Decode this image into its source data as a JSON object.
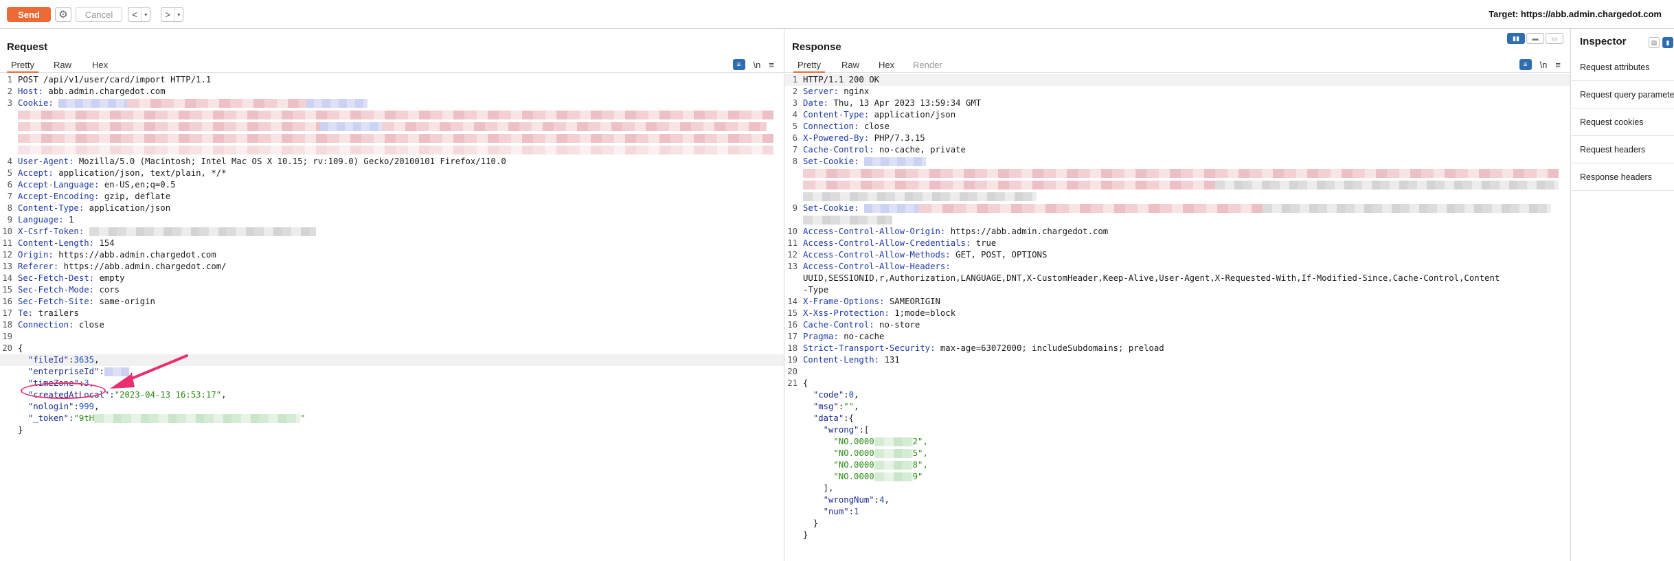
{
  "toolbar": {
    "send_label": "Send",
    "cancel_label": "Cancel",
    "back_glyph": "<",
    "forward_glyph": ">",
    "drop_glyph": "▾",
    "target_label": "Target: https://abb.admin.chargedot.com"
  },
  "request": {
    "title": "Request",
    "tabs": [
      "Pretty",
      "Raw",
      "Hex"
    ],
    "active_tab": "Pretty",
    "newline_label": "\\n",
    "lines": [
      {
        "n": "1",
        "plain": "POST /api/v1/user/card/import HTTP/1.1"
      },
      {
        "n": "2",
        "key": "Host:",
        "val": " abb.admin.chargedot.com"
      },
      {
        "n": "3",
        "key": "Cookie:",
        "val": ""
      },
      {
        "n": "4",
        "key": "User-Agent:",
        "val": " Mozilla/5.0 (Macintosh; Intel Mac OS X 10.15; rv:109.0) Gecko/20100101 Firefox/110.0"
      },
      {
        "n": "5",
        "key": "Accept:",
        "val": " application/json, text/plain, */*"
      },
      {
        "n": "6",
        "key": "Accept-Language:",
        "val": " en-US,en;q=0.5"
      },
      {
        "n": "7",
        "key": "Accept-Encoding:",
        "val": " gzip, deflate"
      },
      {
        "n": "8",
        "key": "Content-Type:",
        "val": " application/json"
      },
      {
        "n": "9",
        "key": "Language:",
        "val": " 1"
      },
      {
        "n": "10",
        "key": "X-Csrf-Token:",
        "val": ""
      },
      {
        "n": "11",
        "key": "Content-Length:",
        "val": " 154"
      },
      {
        "n": "12",
        "key": "Origin:",
        "val": " https://abb.admin.chargedot.com"
      },
      {
        "n": "13",
        "key": "Referer:",
        "val": " https://abb.admin.chargedot.com/"
      },
      {
        "n": "14",
        "key": "Sec-Fetch-Dest:",
        "val": " empty"
      },
      {
        "n": "15",
        "key": "Sec-Fetch-Mode:",
        "val": " cors"
      },
      {
        "n": "16",
        "key": "Sec-Fetch-Site:",
        "val": " same-origin"
      },
      {
        "n": "17",
        "key": "Te:",
        "val": " trailers"
      },
      {
        "n": "18",
        "key": "Connection:",
        "val": " close"
      },
      {
        "n": "19",
        "plain": ""
      },
      {
        "n": "20",
        "plain": "{"
      }
    ],
    "body": {
      "fileId_key": "\"fileId\"",
      "fileId_val": "3635",
      "enterpriseId_key": "\"enterpriseId\"",
      "timeZone_key": "\"timeZone\"",
      "timeZone_val": "3",
      "createdAtLocal_key": "\"createdAtLocal\"",
      "createdAtLocal_val": "\"2023-04-13 16:53:17\"",
      "nologin_key": "\"nologin\"",
      "nologin_val": "999",
      "token_key": "\"_token\"",
      "token_prefix": "\"9tH",
      "token_suffix": "\"",
      "close": "}"
    }
  },
  "response": {
    "title": "Response",
    "tabs": [
      "Pretty",
      "Raw",
      "Hex",
      "Render"
    ],
    "active_tab": "Pretty",
    "newline_label": "\\n",
    "lines": [
      {
        "n": "1",
        "plain": "HTTP/1.1 200 OK"
      },
      {
        "n": "2",
        "key": "Server:",
        "val": " nginx"
      },
      {
        "n": "3",
        "key": "Date:",
        "val": " Thu, 13 Apr 2023 13:59:34 GMT"
      },
      {
        "n": "4",
        "key": "Content-Type:",
        "val": " application/json"
      },
      {
        "n": "5",
        "key": "Connection:",
        "val": " close"
      },
      {
        "n": "6",
        "key": "X-Powered-By:",
        "val": " PHP/7.3.15"
      },
      {
        "n": "7",
        "key": "Cache-Control:",
        "val": " no-cache, private"
      },
      {
        "n": "8",
        "key": "Set-Cookie:",
        "val": ""
      },
      {
        "n": "9",
        "key": "Set-Cookie:",
        "val": ""
      },
      {
        "n": "10",
        "key": "Access-Control-Allow-Origin:",
        "val": " https://abb.admin.chargedot.com"
      },
      {
        "n": "11",
        "key": "Access-Control-Allow-Credentials:",
        "val": " true"
      },
      {
        "n": "12",
        "key": "Access-Control-Allow-Methods:",
        "val": " GET, POST, OPTIONS"
      },
      {
        "n": "13",
        "key": "Access-Control-Allow-Headers:",
        "val": ""
      },
      {
        "n": "",
        "plain": "UUID,SESSIONID,r,Authorization,LANGUAGE,DNT,X-CustomHeader,Keep-Alive,User-Agent,X-Requested-With,If-Modified-Since,Cache-Control,Content"
      },
      {
        "n": "",
        "plain": "-Type"
      },
      {
        "n": "14",
        "key": "X-Frame-Options:",
        "val": " SAMEORIGIN"
      },
      {
        "n": "15",
        "key": "X-Xss-Protection:",
        "val": " 1;mode=block"
      },
      {
        "n": "16",
        "key": "Cache-Control:",
        "val": " no-store"
      },
      {
        "n": "17",
        "key": "Pragma:",
        "val": " no-cache"
      },
      {
        "n": "18",
        "key": "Strict-Transport-Security:",
        "val": " max-age=63072000; includeSubdomains; preload"
      },
      {
        "n": "19",
        "key": "Content-Length:",
        "val": " 131"
      },
      {
        "n": "20",
        "plain": ""
      },
      {
        "n": "21",
        "plain": "{"
      }
    ],
    "body": {
      "code_key": "\"code\"",
      "code_val": "0",
      "msg_key": "\"msg\"",
      "msg_val": "\"\"",
      "data_key": "\"data\"",
      "wrong_key": "\"wrong\"",
      "wrong_items": [
        {
          "prefix": "\"NO.0000",
          "suffix": "2\","
        },
        {
          "prefix": "\"NO.0000",
          "suffix": "5\","
        },
        {
          "prefix": "\"NO.0000",
          "suffix": "8\","
        },
        {
          "prefix": "\"NO.0000",
          "suffix": "9\""
        }
      ],
      "wrongNum_key": "\"wrongNum\"",
      "wrongNum_val": "4",
      "num_key": "\"num\"",
      "num_val": "1"
    }
  },
  "inspector": {
    "title": "Inspector",
    "items": [
      "Request attributes",
      "Request query parameters",
      "Request cookies",
      "Request headers",
      "Response headers"
    ]
  },
  "colors": {
    "accent": "#ed6a36",
    "annotation": "#ea2f6e",
    "header_key": "#1f3aa6",
    "json_string": "#2a8a14"
  }
}
